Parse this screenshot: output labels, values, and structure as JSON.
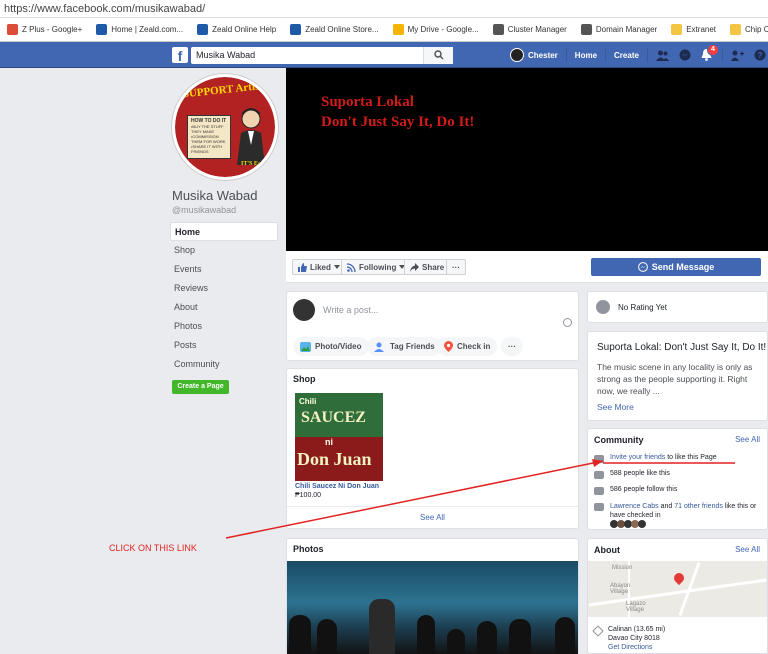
{
  "browser": {
    "url": "https://www.facebook.com/musikawabad/",
    "bookmarks": [
      {
        "label": "Z Plus - Google+",
        "icon": "google-plus-icon",
        "color": "#dd4b39"
      },
      {
        "label": "Home | Zeald.com...",
        "icon": "zeald-icon",
        "color": "#1e5aa8"
      },
      {
        "label": "Zeald Online Help",
        "icon": "zeald-icon",
        "color": "#1e5aa8"
      },
      {
        "label": "Zeald Online Store...",
        "icon": "zeald-store-icon",
        "color": "#1e5aa8"
      },
      {
        "label": "My Drive - Google...",
        "icon": "google-drive-icon",
        "color": "#f4b400"
      },
      {
        "label": "Cluster Manager",
        "icon": "globe-icon",
        "color": "#555555"
      },
      {
        "label": "Domain Manager",
        "icon": "globe-icon",
        "color": "#555555"
      },
      {
        "label": "Extranet",
        "icon": "folder-icon",
        "color": "#f4c542"
      },
      {
        "label": "Chip Canoni",
        "icon": "folder-icon",
        "color": "#f4c542"
      }
    ]
  },
  "header": {
    "logo": "f",
    "search_value": "Musika Wabad",
    "user_name": "Chester",
    "home_label": "Home",
    "create_label": "Create",
    "notif_count": "4"
  },
  "page": {
    "name": "Musika Wabad",
    "handle": "@musikawabad",
    "profile_art": {
      "title": "SUPPORT Artists",
      "box_title": "HOW TO DO IT",
      "box_lines": [
        "•BUY THE STUFF THEY MAKE",
        "•COMMISSION THEM FOR WORK",
        "•SHARE IT WITH FRIENDS"
      ],
      "side": "IT'S Easy"
    },
    "nav": [
      "Home",
      "Shop",
      "Events",
      "Reviews",
      "About",
      "Photos",
      "Posts",
      "Community"
    ],
    "create_page": "Create a Page"
  },
  "cover": {
    "line1": "Suporta Lokal",
    "line2": "Don't Just Say It, Do It!"
  },
  "actions": {
    "liked": "Liked",
    "following": "Following",
    "share": "Share",
    "more": "···",
    "send_message": "Send Message"
  },
  "composer": {
    "placeholder": "Write a post...",
    "photo_video": "Photo/Video",
    "tag_friends": "Tag Friends",
    "check_in": "Check in",
    "more": "···"
  },
  "shop": {
    "title": "Shop",
    "product_name": "Chili Saucez Ni Don Juan",
    "product_price": "₱100.00",
    "image_text": [
      "Chili",
      "SAUCEZ",
      "ni",
      "Don Juan"
    ],
    "see_all": "See All"
  },
  "photos": {
    "title": "Photos"
  },
  "rating": {
    "text": "No Rating Yet"
  },
  "about_blurb": {
    "title": "Suporta Lokal: Don't Just Say It, Do It!",
    "text": "The music scene in any locality is only as strong as the people supporting it. Right now, we really ...",
    "see_more": "See More"
  },
  "community": {
    "title": "Community",
    "see_all": "See All",
    "invite_link": "Invite your friends",
    "invite_rest": " to like this Page",
    "likes": "588 people like this",
    "follows": "586 people follow this",
    "friend1": "Lawrence Cabs",
    "and": " and ",
    "friend_others": "71 other friends",
    "checked_rest": " like this or have checked in"
  },
  "about": {
    "title": "About",
    "see_all": "See All",
    "map_labels": [
      "Abayon Village",
      "Lagazo Village",
      "Mission"
    ],
    "address_line1": "Calinan (13.65 mi)",
    "address_line2": "Davao City 8018",
    "directions": "Get Directions"
  },
  "annotation": {
    "text": "CLICK ON THIS LINK",
    "color": "#e32222"
  }
}
